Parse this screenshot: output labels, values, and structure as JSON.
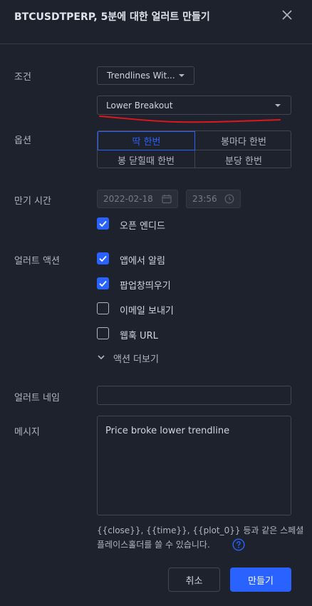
{
  "dialog": {
    "title": "BTCUSDTPERP, 5분에 대한 얼러트 만들기"
  },
  "condition": {
    "label": "조건",
    "source_value": "Trendlines Wit...",
    "type_value": "Lower Breakout"
  },
  "options": {
    "label": "옵션",
    "items": [
      "딱 한번",
      "봉마다 한번",
      "봉 닫힐때 한번",
      "분당 한번"
    ],
    "selected_index": 0
  },
  "expiration": {
    "label": "만기 시간",
    "date_value": "2022-02-18",
    "time_value": "23:56",
    "open_ended_label": "오픈 엔디드",
    "open_ended_checked": true
  },
  "alert_actions": {
    "label": "얼러트 액션",
    "items": [
      {
        "label": "앱에서 알림",
        "checked": true
      },
      {
        "label": "팝업창띄우기",
        "checked": true
      },
      {
        "label": "이메일 보내기",
        "checked": false
      },
      {
        "label": "웹훅 URL",
        "checked": false
      }
    ],
    "more_label": "액션 더보기"
  },
  "alert_name": {
    "label": "얼러트 네임",
    "value": ""
  },
  "message": {
    "label": "메시지",
    "value": "Price broke lower trendline"
  },
  "hint": {
    "line1": "{{close}}, {{time}}, {{plot_0}} 등과 같은 스페셜",
    "line2": "플레이스홀더를 쓸 수 있습니다."
  },
  "footer": {
    "cancel_label": "취소",
    "create_label": "만들기"
  },
  "colors": {
    "background": "#1e222d",
    "accent": "#2962ff",
    "annotation": "#e0161d"
  }
}
